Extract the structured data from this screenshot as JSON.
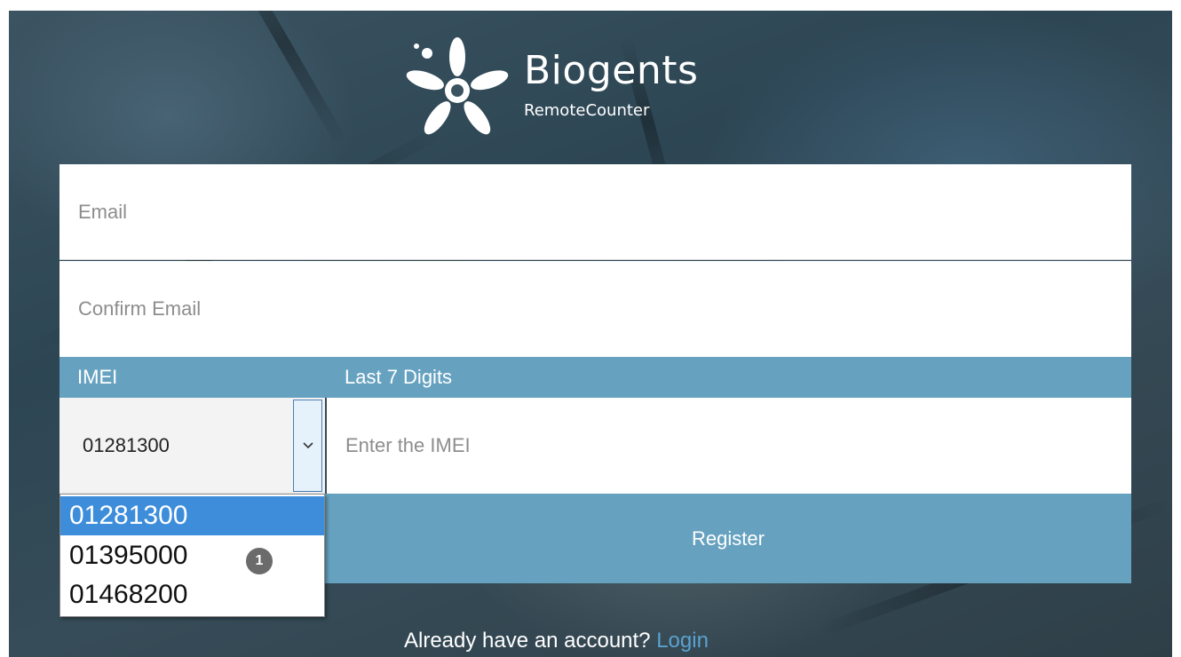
{
  "brand": {
    "name": "Biogents",
    "product": "RemoteCounter",
    "logo_icon": "star-figure-logo-icon"
  },
  "form": {
    "email_placeholder": "Email",
    "confirm_email_placeholder": "Confirm Email",
    "imei_label": "IMEI",
    "last_digits_label": "Last 7 Digits",
    "imei_prefix_selected": "01281300",
    "imei_prefix_options": [
      "01281300",
      "01395000",
      "01468200"
    ],
    "imei_placeholder": "Enter the IMEI",
    "register_label": "Register"
  },
  "annotation": {
    "badge": "1"
  },
  "footer": {
    "prompt": "Already have an account?",
    "login_link": "Login"
  },
  "colors": {
    "accent": "#66a2c0",
    "selected_option": "#3d8ddb",
    "link": "#5aa2d0"
  }
}
